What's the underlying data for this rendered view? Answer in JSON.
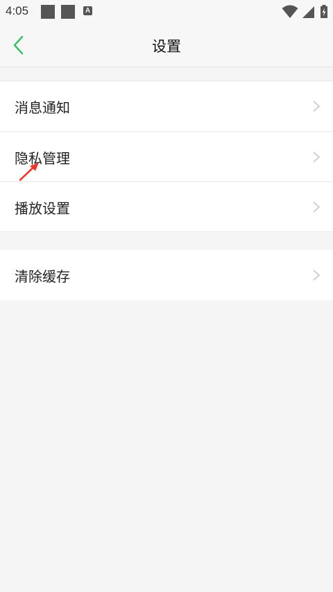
{
  "status_bar": {
    "time": "4:05",
    "icons": [
      "notification-square-icon",
      "notification-square-icon",
      "a-icon",
      "wifi-icon",
      "signal-icon",
      "battery-charging-icon"
    ],
    "a_glyph": "A"
  },
  "navbar": {
    "title": "设置",
    "back_icon": "chevron-left-icon",
    "accent_color": "#3ec06a"
  },
  "settings_groups": [
    {
      "items": [
        {
          "label": "消息通知"
        },
        {
          "label": "隐私管理"
        },
        {
          "label": "播放设置"
        }
      ]
    },
    {
      "items": [
        {
          "label": "清除缓存"
        }
      ]
    }
  ],
  "annotation": {
    "icon": "red-arrow-icon",
    "color": "#e8382d"
  }
}
